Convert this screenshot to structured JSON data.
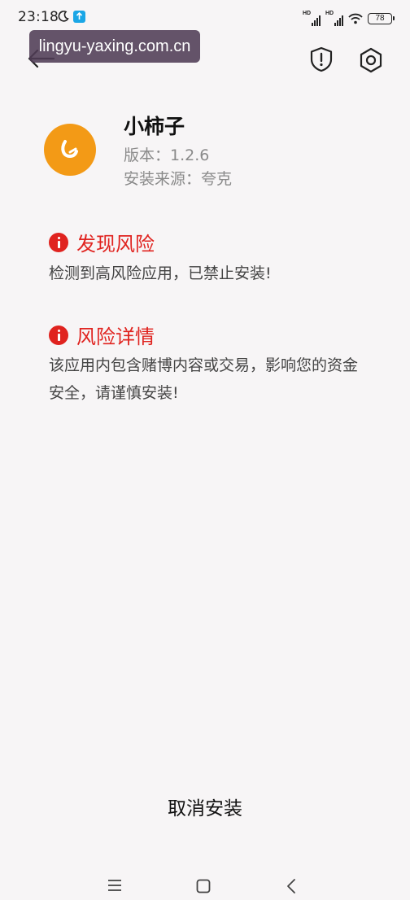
{
  "status_bar": {
    "time": "23:18",
    "battery": "78",
    "hd_label": "HD"
  },
  "watermark": {
    "text": "lingyu-yaxing.com.cn"
  },
  "app": {
    "name": "小柿子",
    "version": "版本：1.2.6",
    "source": "安装来源：夸克",
    "icon_color": "#f39a16"
  },
  "risk_found": {
    "title": "发现风险",
    "body": "检测到高风险应用，已禁止安装!"
  },
  "risk_detail": {
    "title": "风险详情",
    "body": "该应用内包含赌博内容或交易，影响您的资金安全，请谨慎安装!"
  },
  "actions": {
    "cancel_label": "取消安装"
  },
  "colors": {
    "risk": "#e0231f",
    "background": "#f7f5f6",
    "secondary_text": "#8a8a8a"
  },
  "icons": {
    "back": "back-arrow-icon",
    "shield": "shield-alert-icon",
    "settings": "hexagon-settings-icon",
    "alert": "alert-circle-icon",
    "moon": "moon-icon",
    "nav_menu": "menu-icon",
    "nav_home": "home-icon",
    "nav_back": "chevron-left-icon"
  }
}
